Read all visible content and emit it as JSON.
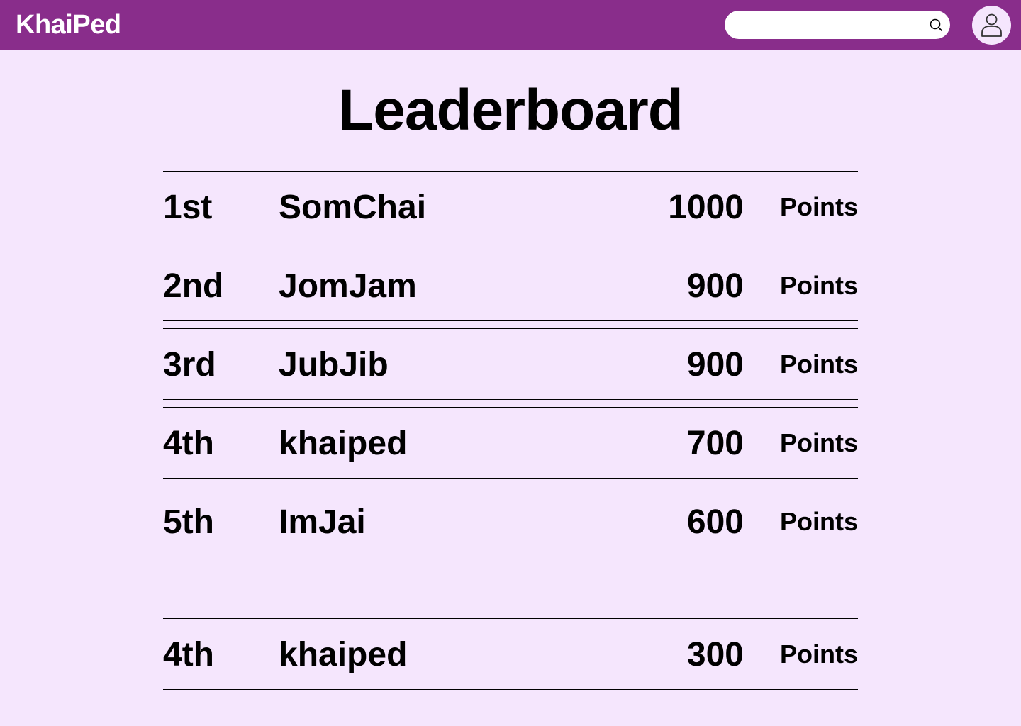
{
  "app": {
    "logo": "KhaiPed"
  },
  "search": {
    "value": "",
    "placeholder": ""
  },
  "page": {
    "title": "Leaderboard"
  },
  "leaderboard": [
    {
      "rank": "1st",
      "name": "SomChai",
      "score": "1000",
      "unit": "Points"
    },
    {
      "rank": "2nd",
      "name": "JomJam",
      "score": "900",
      "unit": "Points"
    },
    {
      "rank": "3rd",
      "name": "JubJib",
      "score": "900",
      "unit": "Points"
    },
    {
      "rank": "4th",
      "name": "khaiped",
      "score": "700",
      "unit": "Points"
    },
    {
      "rank": "5th",
      "name": "ImJai",
      "score": "600",
      "unit": "Points"
    }
  ],
  "current_user": {
    "rank": "4th",
    "name": "khaiped",
    "score": "300",
    "unit": "Points"
  },
  "colors": {
    "topbar": "#892d8b",
    "background": "#f5e6fd"
  },
  "icons": {
    "search": "search-icon",
    "avatar": "user-icon"
  }
}
